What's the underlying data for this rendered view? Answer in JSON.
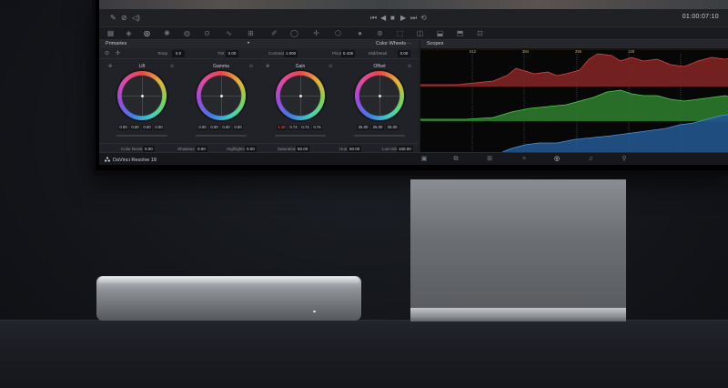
{
  "transport": {
    "timecode": "01:00:07:10"
  },
  "primaries": {
    "title": "Primaries",
    "mode": "Color Wheels",
    "params": [
      {
        "label": "Temp",
        "value": "0.0"
      },
      {
        "label": "Tint",
        "value": "0.00"
      },
      {
        "label": "Contrast",
        "value": "1.000"
      },
      {
        "label": "Pivot",
        "value": "0.435"
      },
      {
        "label": "Mid/Detail",
        "value": "0.00"
      }
    ],
    "wheels": [
      {
        "name": "Lift",
        "values": [
          "0.00",
          "0.00",
          "0.00",
          "0.00"
        ]
      },
      {
        "name": "Gamma",
        "values": [
          "0.00",
          "0.00",
          "0.00",
          "0.00"
        ]
      },
      {
        "name": "Gain",
        "values": [
          "1.16",
          "0.74",
          "0.74",
          "0.74"
        ]
      },
      {
        "name": "Offset",
        "values": [
          "25.00",
          "25.00",
          "25.00"
        ]
      }
    ],
    "bottom_params": [
      {
        "label": "Color Boost",
        "value": "0.00"
      },
      {
        "label": "Shadows",
        "value": "0.00"
      },
      {
        "label": "Highlights",
        "value": "0.00"
      },
      {
        "label": "Saturation",
        "value": "50.00"
      },
      {
        "label": "Hue",
        "value": "50.00"
      },
      {
        "label": "Lum Mix",
        "value": "100.00"
      }
    ]
  },
  "scopes": {
    "title": "Scopes",
    "ticks": [
      "512",
      "384",
      "256",
      "128"
    ]
  },
  "footer": {
    "app_name": "DaVinci Resolve 18"
  }
}
